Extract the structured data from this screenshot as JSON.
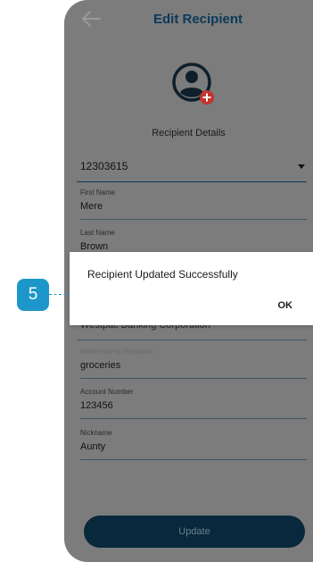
{
  "header": {
    "title": "Edit Recipient",
    "back_icon": "arrow-left-icon"
  },
  "avatar": {
    "icon": "user-avatar-icon",
    "badge_icon": "plus-icon",
    "badge_color": "#c0352c"
  },
  "section": {
    "label": "Recipient Details"
  },
  "recipient_select": {
    "value": "12303615"
  },
  "fields": {
    "first_name": {
      "label": "First Name",
      "value": "Mere"
    },
    "last_name": {
      "label": "Last Name",
      "value": "Brown"
    },
    "bank_name": {
      "value": "Westpac Banking Corporation"
    },
    "reference": {
      "label": "Reference to Recipient",
      "value": "groceries"
    },
    "account_number": {
      "label": "Account Number",
      "value": "123456"
    },
    "nickname": {
      "label": "Nickname",
      "value": "Aunty"
    }
  },
  "actions": {
    "update_label": "Update"
  },
  "dialog": {
    "message": "Recipient Updated Successfully",
    "ok_label": "OK"
  },
  "callout": {
    "step_number": "5",
    "color": "#1d97c9"
  },
  "colors": {
    "brand_dark": "#0b3a5a",
    "overlay": "#7c7c7c"
  }
}
